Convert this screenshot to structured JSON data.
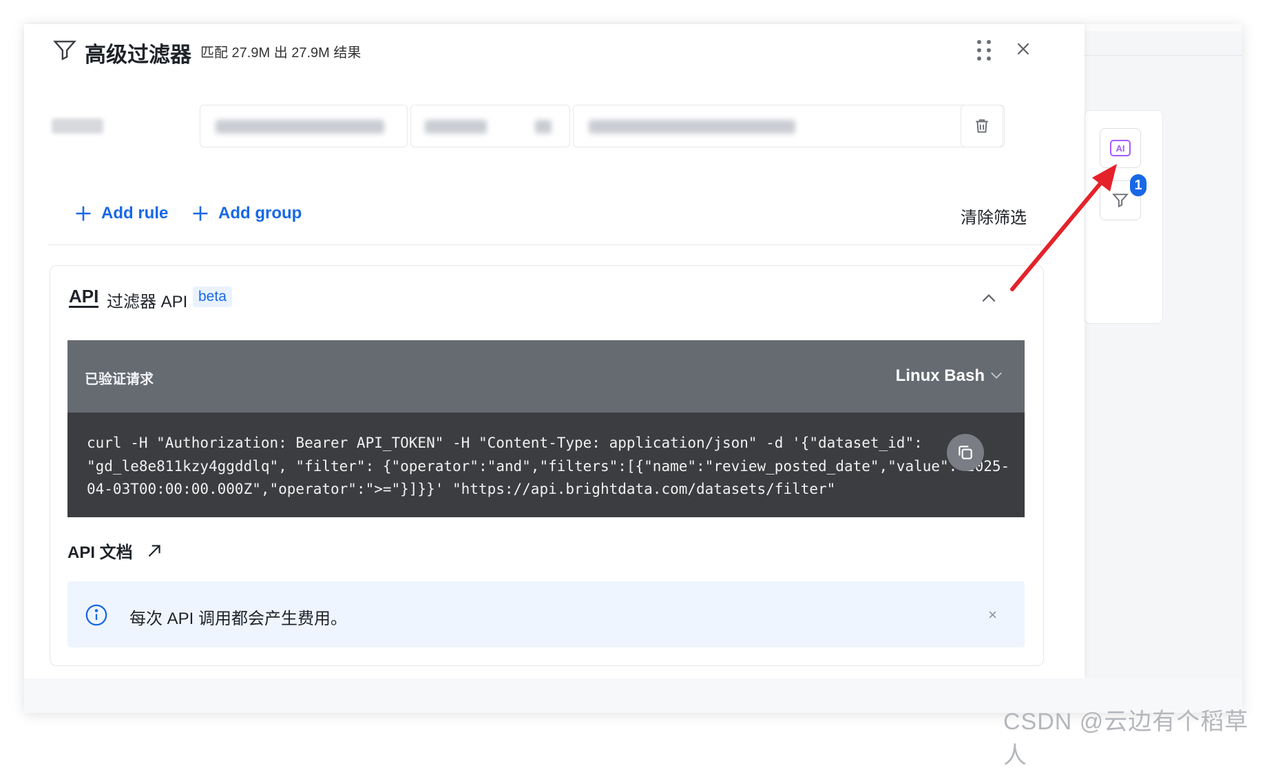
{
  "header": {
    "title": "高级过滤器",
    "match_text": "匹配 27.9M 出 27.9M 结果"
  },
  "actions": {
    "add_rule": "Add rule",
    "add_group": "Add group",
    "clear_filter": "清除筛选"
  },
  "api_panel": {
    "logo": "API",
    "title": "过滤器 API",
    "beta": "beta",
    "request_label": "已验证请求",
    "language": "Linux Bash",
    "code_lines": [
      "curl -H \"Authorization: Bearer API_TOKEN\" -H \"Content-Type: application/json\" -d '{\"dataset_id\":",
      "\"gd_le8e811kzy4ggddlq\", \"filter\": {\"operator\":\"and\",\"filters\":[{\"name\":\"review_posted_date\",\"value\":\"2025-",
      "04-03T00:00:00.000Z\",\"operator\":\">=\"}]}}' \"https://api.brightdata.com/datasets/filter\""
    ],
    "docs_link": "API 文档",
    "notice": "每次 API 调用都会产生费用。",
    "notice_close": "×"
  },
  "side": {
    "ai_label": "AI",
    "filter_count": "1"
  },
  "watermark": "CSDN @云边有个稻草人",
  "colors": {
    "accent": "#1868e6",
    "ai_purple": "#a35bff",
    "annotation_arrow": "#e5222a",
    "code_bg": "#3b3d40",
    "code_header_bg": "#666b72",
    "notice_bg": "#eef5fe"
  },
  "icons": {
    "header": "filter-funnel-icon",
    "drag": "drag-handle-icon",
    "close": "close-icon",
    "trash": "trash-icon",
    "add": "plus-icon",
    "collapse": "chevron-up-icon",
    "lang": "chevron-down-icon",
    "copy": "copy-icon",
    "external": "external-link-icon",
    "info": "info-icon"
  }
}
